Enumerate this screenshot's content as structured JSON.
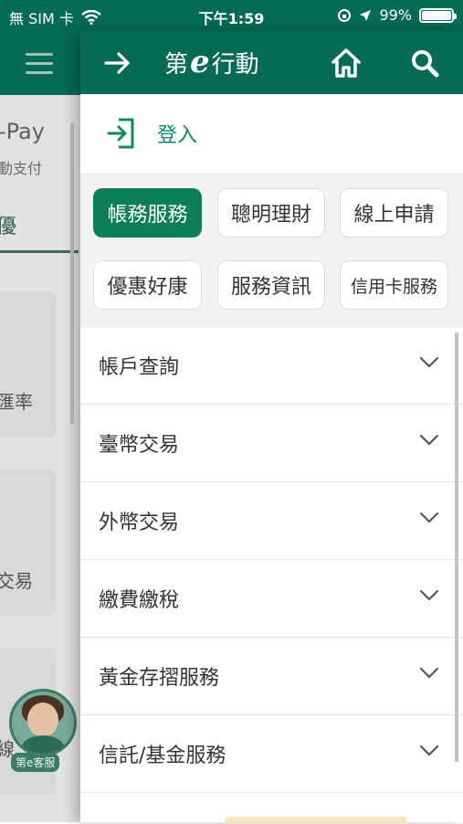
{
  "status_bar": {
    "carrier": "無 SIM 卡",
    "time": "下午1:59",
    "battery": "99%",
    "battery_level": 0.99
  },
  "background_app": {
    "pay_label": "-Pay",
    "pay_sub": "動支付",
    "tab_fragment": "優",
    "card1_text": "匯率",
    "card2_text": "交易",
    "card3_text": "線",
    "assistant_badge": "第e客服"
  },
  "drawer": {
    "brand_prefix": "第",
    "brand_e": "e",
    "brand_suffix": "行動",
    "login_label": "登入",
    "tabs": [
      {
        "label": "帳務服務",
        "active": true
      },
      {
        "label": "聰明理財",
        "active": false
      },
      {
        "label": "線上申請",
        "active": false
      },
      {
        "label": "優惠好康",
        "active": false
      },
      {
        "label": "服務資訊",
        "active": false
      },
      {
        "label": "信用卡服務",
        "active": false
      }
    ],
    "menu": [
      {
        "label": "帳戶查詢"
      },
      {
        "label": "臺幣交易"
      },
      {
        "label": "外幣交易"
      },
      {
        "label": "繳費繳稅"
      },
      {
        "label": "黃金存摺服務"
      },
      {
        "label": "信託/基金服務"
      }
    ]
  },
  "colors": {
    "primary": "#056b52",
    "accent": "#0c7f5a",
    "login_text": "#0e8a63"
  },
  "icons": {
    "back": "arrow-right-icon",
    "home": "home-icon",
    "search": "search-icon",
    "login": "login-icon",
    "chevron": "chevron-down-icon"
  }
}
